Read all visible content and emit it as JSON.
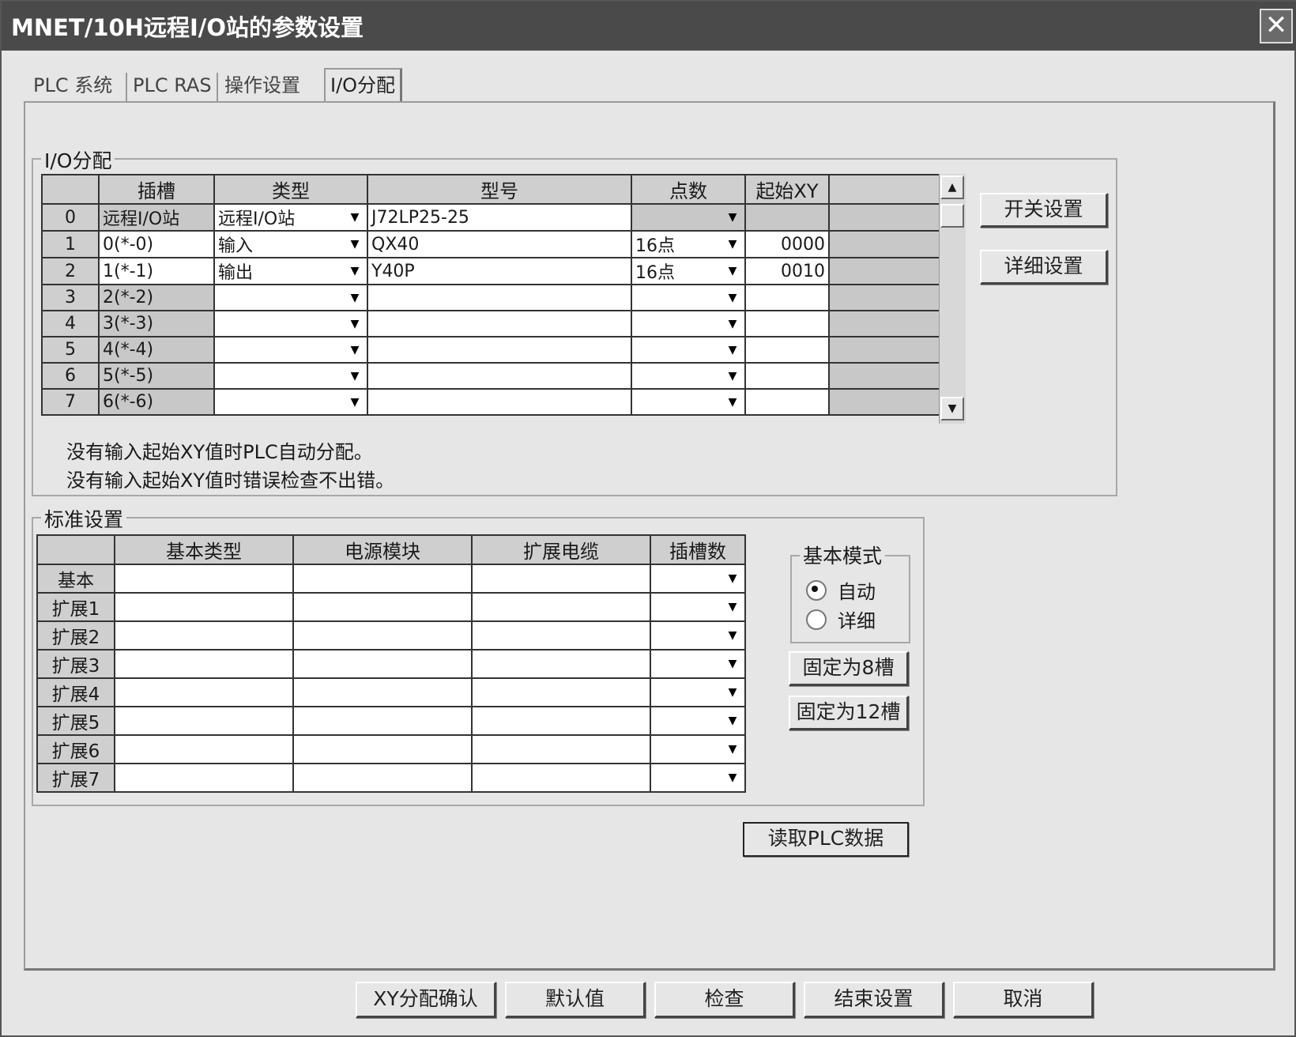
{
  "window": {
    "title": "MNET/10H远程I/O站的参数设置",
    "close_glyph": "✕"
  },
  "tabs": [
    {
      "label": "PLC 系统",
      "active": false
    },
    {
      "label": "PLC RAS",
      "active": false
    },
    {
      "label": "操作设置",
      "active": false
    },
    {
      "label": "I/O分配",
      "active": true
    }
  ],
  "io_assignment": {
    "group_label": "I/O分配",
    "columns": [
      "",
      "插槽",
      "类型",
      "型号",
      "点数",
      "起始XY",
      ""
    ],
    "rows": [
      {
        "num": "0",
        "slot": "远程I/O站",
        "type": "远程I/O站",
        "model": "J72LP25-25",
        "points": "",
        "start_xy": ""
      },
      {
        "num": "1",
        "slot": "0(*-0)",
        "type": "输入",
        "model": "QX40",
        "points": "16点",
        "start_xy": "0000"
      },
      {
        "num": "2",
        "slot": "1(*-1)",
        "type": "输出",
        "model": "Y40P",
        "points": "16点",
        "start_xy": "0010"
      },
      {
        "num": "3",
        "slot": "2(*-2)",
        "type": "",
        "model": "",
        "points": "",
        "start_xy": ""
      },
      {
        "num": "4",
        "slot": "3(*-3)",
        "type": "",
        "model": "",
        "points": "",
        "start_xy": ""
      },
      {
        "num": "5",
        "slot": "4(*-4)",
        "type": "",
        "model": "",
        "points": "",
        "start_xy": ""
      },
      {
        "num": "6",
        "slot": "5(*-5)",
        "type": "",
        "model": "",
        "points": "",
        "start_xy": ""
      },
      {
        "num": "7",
        "slot": "6(*-6)",
        "type": "",
        "model": "",
        "points": "",
        "start_xy": ""
      }
    ],
    "note1": "没有输入起始XY值时PLC自动分配。",
    "note2": "没有输入起始XY值时错误检查不出错。",
    "switch_button": "开关设置",
    "detail_button": "详细设置"
  },
  "standard": {
    "group_label": "标准设置",
    "columns": [
      "",
      "基本类型",
      "电源模块",
      "扩展电缆",
      "插槽数"
    ],
    "rows": [
      "基本",
      "扩展1",
      "扩展2",
      "扩展3",
      "扩展4",
      "扩展5",
      "扩展6",
      "扩展7"
    ]
  },
  "basic_mode": {
    "label": "基本模式",
    "options": [
      {
        "label": "自动",
        "selected": true
      },
      {
        "label": "详细",
        "selected": false
      }
    ],
    "fix8_button": "固定为8槽",
    "fix12_button": "固定为12槽"
  },
  "read_plc_button": "读取PLC数据",
  "footer": {
    "xy_confirm": "XY分配确认",
    "default": "默认值",
    "check": "检查",
    "finish": "结束设置",
    "cancel": "取消"
  },
  "icons": {
    "dropdown": "▼",
    "scroll_up": "▲",
    "scroll_down": "▼"
  }
}
